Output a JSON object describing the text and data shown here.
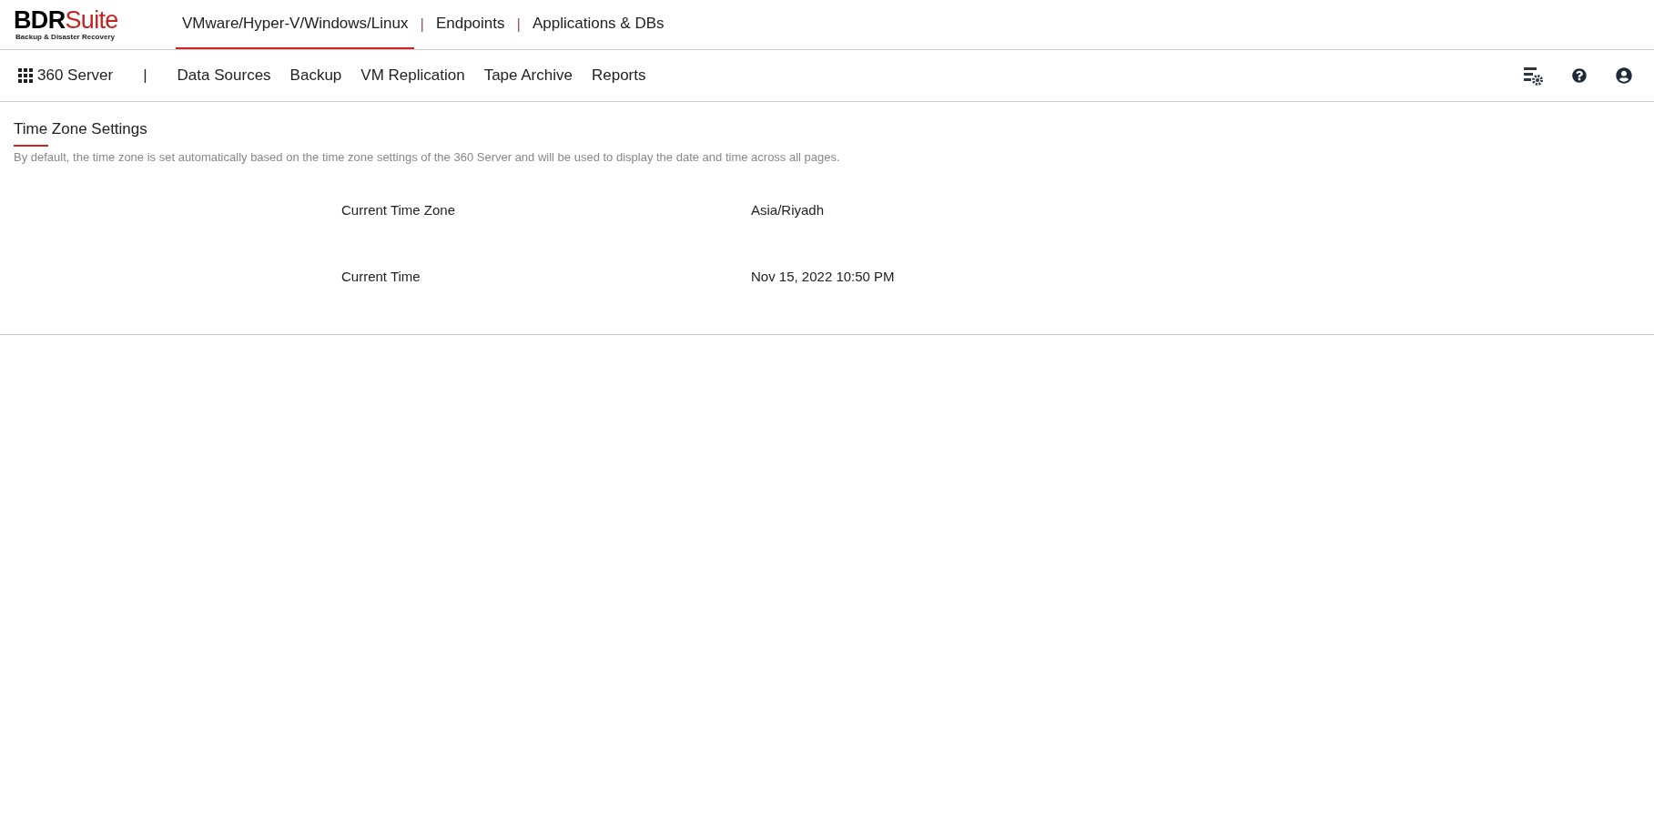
{
  "logo": {
    "brand": "BDR",
    "brand_accent": "Suite",
    "tagline": "Backup & Disaster Recovery"
  },
  "top_nav": {
    "separator": "|",
    "tabs": [
      {
        "label": "VMware/Hyper-V/Windows/Linux",
        "selected": true
      },
      {
        "label": "Endpoints",
        "selected": false
      },
      {
        "label": "Applications & DBs",
        "selected": false
      }
    ]
  },
  "sub_nav": {
    "server": "360 Server",
    "separator": "|",
    "items": [
      {
        "label": "Data Sources"
      },
      {
        "label": "Backup"
      },
      {
        "label": "VM Replication"
      },
      {
        "label": "Tape Archive"
      },
      {
        "label": "Reports"
      }
    ]
  },
  "page": {
    "title": "Time Zone Settings",
    "description": "By default, the time zone is set automatically based on the time zone settings of the 360 Server and will be used to display the date and time across all pages.",
    "fields": [
      {
        "label": "Current Time Zone",
        "value": "Asia/Riyadh"
      },
      {
        "label": "Current Time",
        "value": "Nov 15, 2022 10:50 PM"
      }
    ]
  }
}
